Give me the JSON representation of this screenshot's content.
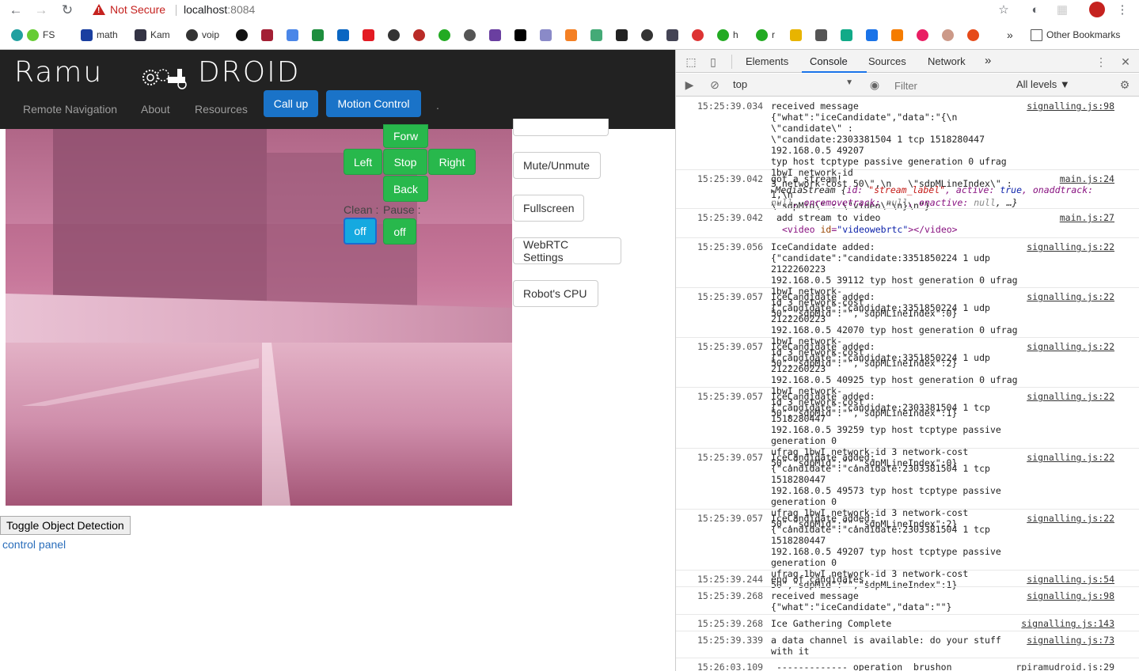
{
  "browser": {
    "security_label": "Not Secure",
    "url_host": "localhost",
    "url_port": ":8084",
    "bookmarks": [
      {
        "label": "FS",
        "icon": "quora-icon",
        "color": "#20a0a0"
      },
      {
        "label": "math",
        "icon": "v-icon",
        "color": "#1a3fa0"
      },
      {
        "label": "Kam",
        "icon": "kam-icon",
        "color": "#334"
      },
      {
        "label": "voip",
        "icon": "globe-icon",
        "color": "#333"
      },
      {
        "label": "h",
        "icon": "cloud-icon",
        "color": "#2a2"
      },
      {
        "label": "r",
        "icon": "cloud-icon",
        "color": "#2a2"
      }
    ],
    "other_bookmarks": "Other Bookmarks",
    "more_bookmarks": "»"
  },
  "site": {
    "logo_left": "Ramu",
    "logo_right": "DROID",
    "nav": {
      "remote_navigation": "Remote Navigation",
      "about": "About",
      "resources": "Resources",
      "call_up": "Call up",
      "motion_control": "Motion Control",
      "dot": "."
    },
    "controls": {
      "forward": "Forw",
      "left": "Left",
      "stop": "Stop",
      "right": "Right",
      "back": "Back",
      "clean_label": "Clean :",
      "pause_label": "Pause :",
      "clean_value": "off",
      "pause_value": "off"
    },
    "side_buttons": {
      "mute": "Mute/Unmute",
      "fullscreen": "Fullscreen",
      "webrtc": "WebRTC Settings",
      "cpu": "Robot's CPU"
    },
    "toggle_object_detection": "Toggle Object Detection",
    "control_panel_link": "control panel"
  },
  "devtools": {
    "tabs": [
      "Elements",
      "Console",
      "Sources",
      "Network"
    ],
    "active_tab": "Console",
    "more_tabs": "»",
    "context": "top",
    "filter_placeholder": "Filter",
    "levels": "All levels ▼",
    "logs": [
      {
        "ts": "15:25:39.034",
        "msg": "received message\n{\"what\":\"iceCandidate\",\"data\":\"{\\n   \\\"candidate\\\" :\n\\\"candidate:2303381504 1 tcp 1518280447 192.168.0.5 49207\ntyp host tcptype passive generation 0 ufrag 1bwI network-id\n3 network-cost 50\\\",\\n   \\\"sdpMLineIndex\\\" : 1,\\n\n\\\"sdpMid\\\" : \\\"video\\\"\\n}\\n\"}",
        "src": "signalling.js:98"
      },
      {
        "ts": "15:25:39.042",
        "msg": "got a stream!",
        "src": "main.js:24"
      },
      {
        "ts": "15:25:39.042",
        "msg": " add stream to video",
        "src": "main.js:27"
      },
      {
        "ts": "15:25:39.056",
        "msg": "IceCandidate added:\n{\"candidate\":\"candidate:3351850224 1 udp 2122260223\n192.168.0.5 39112 typ host generation 0 ufrag 1bwI network-\nid 3 network-cost 50\",\"sdpMid\":\"\",\"sdpMLineIndex\":0}",
        "src": "signalling.js:22"
      },
      {
        "ts": "15:25:39.057",
        "msg": "IceCandidate added:\n{\"candidate\":\"candidate:3351850224 1 udp 2122260223\n192.168.0.5 42070 typ host generation 0 ufrag 1bwI network-\nid 3 network-cost 50\",\"sdpMid\":\"\",\"sdpMLineIndex\":2}",
        "src": "signalling.js:22"
      },
      {
        "ts": "15:25:39.057",
        "msg": "IceCandidate added:\n{\"candidate\":\"candidate:3351850224 1 udp 2122260223\n192.168.0.5 40925 typ host generation 0 ufrag 1bwI network-\nid 3 network-cost 50\",\"sdpMid\":\"\",\"sdpMLineIndex\":1}",
        "src": "signalling.js:22"
      },
      {
        "ts": "15:25:39.057",
        "msg": "IceCandidate added:\n{\"candidate\":\"candidate:2303381504 1 tcp 1518280447\n192.168.0.5 39259 typ host tcptype passive generation 0\nufrag 1bwI network-id 3 network-cost\n50\",\"sdpMid\":\"\",\"sdpMLineIndex\":0}",
        "src": "signalling.js:22"
      },
      {
        "ts": "15:25:39.057",
        "msg": "IceCandidate added:\n{\"candidate\":\"candidate:2303381504 1 tcp 1518280447\n192.168.0.5 49573 typ host tcptype passive generation 0\nufrag 1bwI network-id 3 network-cost\n50\",\"sdpMid\":\"\",\"sdpMLineIndex\":2}",
        "src": "signalling.js:22"
      },
      {
        "ts": "15:25:39.057",
        "msg": "IceCandidate added:\n{\"candidate\":\"candidate:2303381504 1 tcp 1518280447\n192.168.0.5 49207 typ host tcptype passive generation 0\nufrag 1bwI network-id 3 network-cost\n50\",\"sdpMid\":\"\",\"sdpMLineIndex\":1}",
        "src": "signalling.js:22"
      },
      {
        "ts": "15:25:39.244",
        "msg": "end of candidates.",
        "src": "signalling.js:54"
      },
      {
        "ts": "15:25:39.268",
        "msg": "received message\n{\"what\":\"iceCandidate\",\"data\":\"\"}",
        "src": "signalling.js:98"
      },
      {
        "ts": "15:25:39.268",
        "msg": "Ice Gathering Complete",
        "src": "signalling.js:143"
      },
      {
        "ts": "15:25:39.339",
        "msg": "a data channel is available: do your stuff\nwith it",
        "src": "signalling.js:73"
      },
      {
        "ts": "15:26:03.109",
        "msg": " ------------- operation  brushon",
        "src": "rpiramudroid.js:29"
      }
    ],
    "stream_detail": {
      "prefix": "MediaStream {",
      "id_key": "id: ",
      "id_val": "\"stream_label\"",
      "active_key": ", active: ",
      "active_val": "true",
      "rest1": ", onaddtrack:",
      "null1": "null",
      "rest2": ", onremovetrack: ",
      "null2": "null",
      "rest3": ", onactive: ",
      "null3": "null",
      "rest4": ", …}"
    },
    "video_tag": {
      "open": "<video ",
      "attr": "id",
      "eq": "=",
      "val": "\"videowebrtc\"",
      "close": "></video>"
    }
  }
}
